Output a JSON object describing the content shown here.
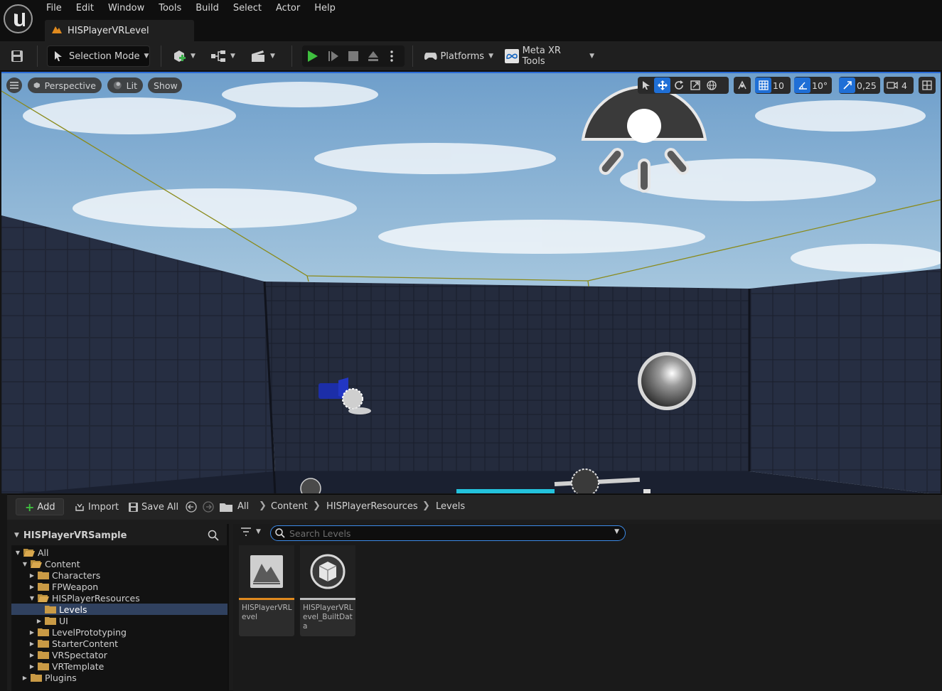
{
  "menu": {
    "logo_icon": "unreal-engine-logo",
    "items": [
      "File",
      "Edit",
      "Window",
      "Tools",
      "Build",
      "Select",
      "Actor",
      "Help"
    ]
  },
  "tab": {
    "title": "HISPlayerVRLevel"
  },
  "toolbar": {
    "selection_mode": "Selection Mode",
    "platforms": "Platforms",
    "meta_xr_tools": "Meta XR Tools"
  },
  "viewport": {
    "perspective": "Perspective",
    "lit": "Lit",
    "show": "Show",
    "grid_snap": "10",
    "rotation_snap": "10°",
    "scale_snap": "0,25",
    "camera_speed": "4"
  },
  "content_browser": {
    "add": "Add",
    "import": "Import",
    "save_all": "Save All",
    "breadcrumbs": [
      "All",
      "Content",
      "HISPlayerResources",
      "Levels"
    ],
    "sources_title": "HISPlayerVRSample",
    "search_placeholder": "Search Levels",
    "tree": [
      {
        "label": "All",
        "depth": 0,
        "expanded": true
      },
      {
        "label": "Content",
        "depth": 1,
        "expanded": true
      },
      {
        "label": "Characters",
        "depth": 2,
        "expanded": false
      },
      {
        "label": "FPWeapon",
        "depth": 2,
        "expanded": false
      },
      {
        "label": "HISPlayerResources",
        "depth": 2,
        "expanded": true
      },
      {
        "label": "Levels",
        "depth": 3,
        "selected": true
      },
      {
        "label": "UI",
        "depth": 3,
        "expanded": false
      },
      {
        "label": "LevelPrototyping",
        "depth": 2,
        "expanded": false
      },
      {
        "label": "StarterContent",
        "depth": 2,
        "expanded": false
      },
      {
        "label": "VRSpectator",
        "depth": 2,
        "expanded": false
      },
      {
        "label": "VRTemplate",
        "depth": 2,
        "expanded": false
      },
      {
        "label": "Plugins",
        "depth": 1,
        "expanded": false
      }
    ],
    "assets": [
      {
        "label": "HISPlayerVRLevel",
        "bar_color": "#e08a1e",
        "icon": "level-map-icon"
      },
      {
        "label": "HISPlayerVRLevel_BuiltData",
        "bar_color": "#bdbdbd",
        "icon": "built-data-cube-icon"
      }
    ]
  }
}
